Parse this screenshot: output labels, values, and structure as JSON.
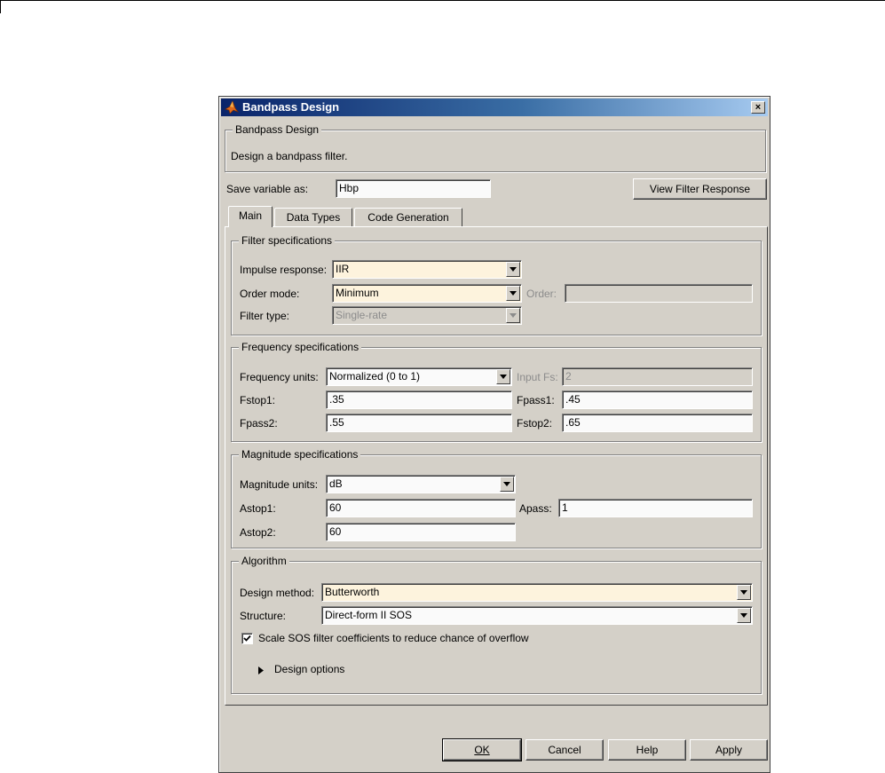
{
  "window": {
    "title": "Bandpass Design",
    "close_glyph": "×"
  },
  "header": {
    "legend": "Bandpass Design",
    "description": "Design a bandpass filter."
  },
  "save": {
    "label": "Save variable as:",
    "value": "Hbp",
    "view_button": "View Filter Response"
  },
  "tabs": [
    {
      "label": "Main",
      "active": true
    },
    {
      "label": "Data Types",
      "active": false
    },
    {
      "label": "Code Generation",
      "active": false
    }
  ],
  "filter_specs": {
    "legend": "Filter specifications",
    "impulse_label": "Impulse response:",
    "impulse_value": "IIR",
    "order_mode_label": "Order mode:",
    "order_mode_value": "Minimum",
    "order_label": "Order:",
    "order_value": "",
    "filter_type_label": "Filter type:",
    "filter_type_value": "Single-rate"
  },
  "freq_specs": {
    "legend": "Frequency specifications",
    "units_label": "Frequency units:",
    "units_value": "Normalized (0 to 1)",
    "input_fs_label": "Input Fs:",
    "input_fs_value": "2",
    "fstop1_label": "Fstop1:",
    "fstop1_value": ".35",
    "fpass1_label": "Fpass1:",
    "fpass1_value": ".45",
    "fpass2_label": "Fpass2:",
    "fpass2_value": ".55",
    "fstop2_label": "Fstop2:",
    "fstop2_value": ".65"
  },
  "mag_specs": {
    "legend": "Magnitude specifications",
    "units_label": "Magnitude units:",
    "units_value": "dB",
    "astop1_label": "Astop1:",
    "astop1_value": "60",
    "apass_label": "Apass:",
    "apass_value": "1",
    "astop2_label": "Astop2:",
    "astop2_value": "60"
  },
  "algorithm": {
    "legend": "Algorithm",
    "method_label": "Design method:",
    "method_value": "Butterworth",
    "structure_label": "Structure:",
    "structure_value": "Direct-form II SOS",
    "scale_label": "Scale SOS filter coefficients to reduce chance of overflow",
    "scale_checked": true,
    "options_label": "Design options"
  },
  "footer": {
    "ok": "OK",
    "cancel": "Cancel",
    "help": "Help",
    "apply": "Apply"
  },
  "colors": {
    "dialog_bg": "#d4d0c8",
    "title_start": "#0a246a",
    "title_end": "#a6caf0",
    "field_bg": "#fdf3dd"
  }
}
